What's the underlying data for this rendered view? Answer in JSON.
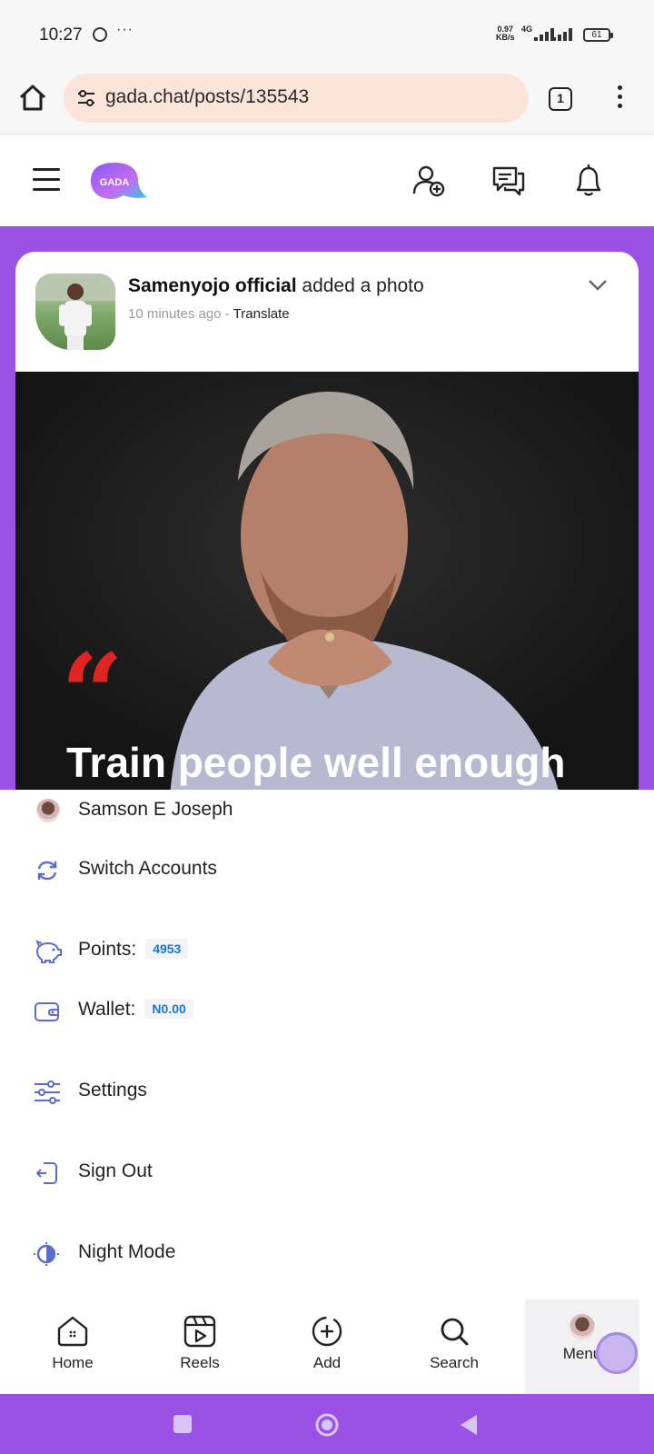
{
  "status_bar": {
    "time": "10:27",
    "speed_value": "0.97",
    "speed_unit": "KB/s",
    "network": "4G",
    "battery": "61"
  },
  "browser": {
    "url": "gada.chat/posts/135543",
    "tab_count": "1"
  },
  "site": {
    "logo_text": "GADA"
  },
  "post": {
    "author": "Samenyojo official",
    "action": "added a photo",
    "time_ago": "10 minutes ago",
    "separator": "-",
    "translate": "Translate",
    "quote_text": "Train people well enough"
  },
  "menu": {
    "account_name": "Samson E Joseph",
    "switch_accounts": "Switch Accounts",
    "points_label": "Points:",
    "points_value": "4953",
    "wallet_label": "Wallet:",
    "wallet_value": "N0.00",
    "settings": "Settings",
    "sign_out": "Sign Out",
    "night_mode": "Night Mode"
  },
  "bottom_nav": {
    "home": "Home",
    "reels": "Reels",
    "add": "Add",
    "search": "Search",
    "menu": "Menu"
  },
  "colors": {
    "brand_purple": "#9a52e6",
    "url_pill": "#fbe4d8",
    "badge_blue": "#1976d2",
    "quote_red": "#e02323"
  }
}
